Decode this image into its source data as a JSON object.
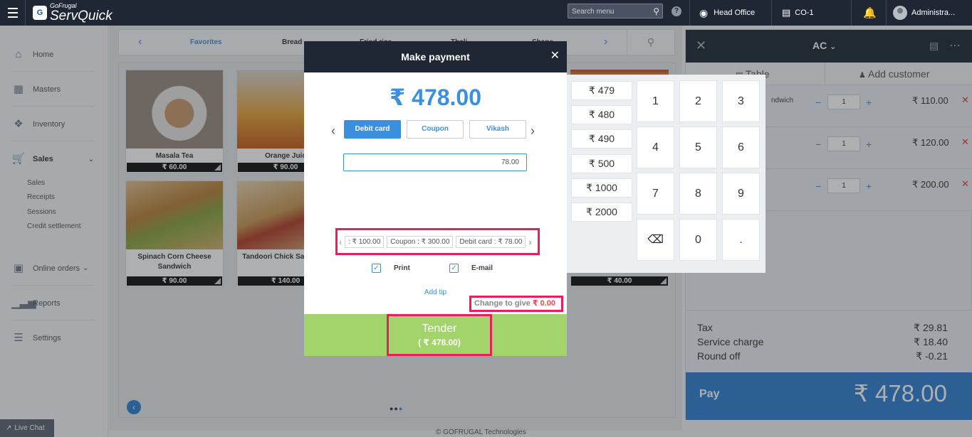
{
  "topbar": {
    "logo_small": "GoFrugal",
    "logo_big": "ServQuick",
    "search_placeholder": "Search menu",
    "location": "Head Office",
    "counter": "CO-1",
    "user": "Administra..."
  },
  "sidebar": {
    "items": [
      {
        "label": "Home",
        "icon": "home-icon"
      },
      {
        "label": "Masters",
        "icon": "masters-icon"
      },
      {
        "label": "Inventory",
        "icon": "inventory-icon"
      },
      {
        "label": "Sales",
        "icon": "cart-icon"
      },
      {
        "label": "Online orders",
        "icon": "online-orders-icon"
      },
      {
        "label": "Reports",
        "icon": "reports-icon"
      },
      {
        "label": "Settings",
        "icon": "settings-icon"
      }
    ],
    "sales_sub": [
      "Sales",
      "Receipts",
      "Sessions",
      "Credit settlement"
    ],
    "live_chat": "Live Chat"
  },
  "categories": [
    "Favorites",
    "Bread",
    "Fried rice",
    "Thali",
    "Shape"
  ],
  "products": [
    {
      "name": "Masala Tea",
      "price": "₹ 60.00"
    },
    {
      "name": "Orange Juic",
      "price": "₹ 90.00"
    },
    {
      "name": "Spinach Corn Cheese Sandwich",
      "price": "₹ 90.00"
    },
    {
      "name": "Tandoori Chick Sandwich",
      "price": "₹ 140.00"
    },
    {
      "name": "",
      "price": "₹ 40.00"
    }
  ],
  "footer": "© GOFRUGAL Technologies",
  "cart": {
    "order_type": "AC",
    "tab_table": "Table",
    "tab_customer": "Add customer",
    "items": [
      {
        "name": "ndwich",
        "qty": "1",
        "amount": "₹ 110.00"
      },
      {
        "name": "",
        "qty": "1",
        "amount": "₹ 120.00"
      },
      {
        "name": "",
        "qty": "1",
        "amount": "₹ 200.00"
      }
    ],
    "summary": [
      {
        "label": "Tax",
        "value": "₹ 29.81"
      },
      {
        "label": "Service charge",
        "value": "₹ 18.40"
      },
      {
        "label": "Round off",
        "value": "₹ -0.21"
      }
    ],
    "pay_label": "Pay",
    "pay_amount": "₹ 478.00"
  },
  "modal": {
    "title": "Make payment",
    "amount": "₹ 478.00",
    "methods": [
      "Debit card",
      "Coupon",
      "Vikash"
    ],
    "input_value": "78.00",
    "splits": [
      ": ₹ 100.00",
      "Coupon : ₹ 300.00",
      "Debit card : ₹ 78.00"
    ],
    "print_label": "Print",
    "email_label": "E-mail",
    "add_tip": "Add tip",
    "change_label": "Change to give",
    "change_value": "₹ 0.00",
    "tender_label": "Tender",
    "tender_amount": "( ₹ 478.00)"
  },
  "keypad": {
    "quick": [
      "₹ 479",
      "₹ 480",
      "₹ 490",
      "₹ 500",
      "₹ 1000",
      "₹ 2000"
    ],
    "keys": [
      "1",
      "2",
      "3",
      "4",
      "5",
      "6",
      "7",
      "8",
      "9",
      "0",
      "."
    ]
  }
}
